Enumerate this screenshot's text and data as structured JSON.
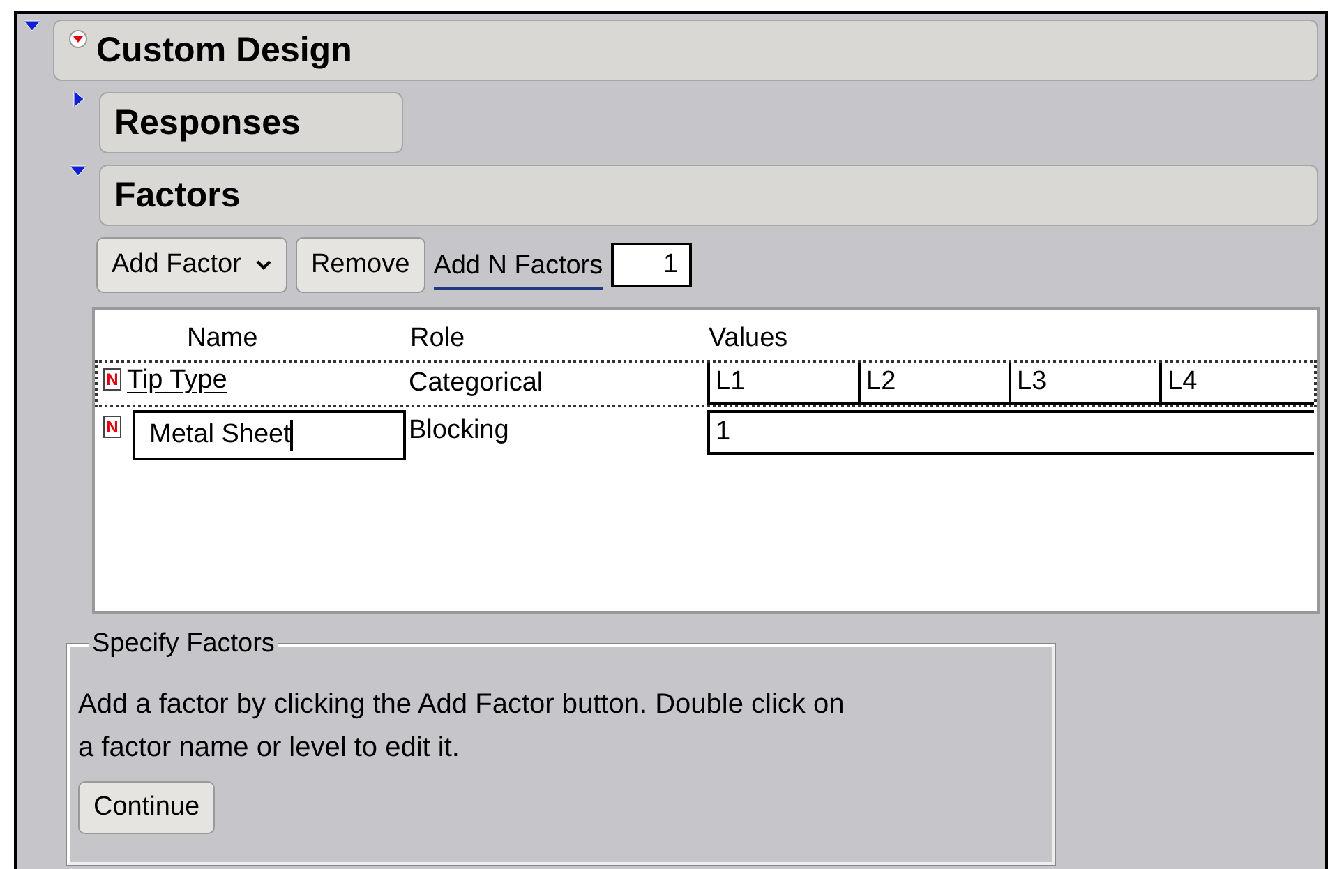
{
  "outline": {
    "title": "Custom Design",
    "expanded": true,
    "menu_open": false,
    "sections": [
      {
        "title": "Responses",
        "expanded": false
      },
      {
        "title": "Factors",
        "expanded": true
      }
    ]
  },
  "toolbar": {
    "add_factor": "Add Factor",
    "remove": "Remove",
    "add_n_label": "Add N Factors",
    "add_n_value": "1"
  },
  "table": {
    "columns": [
      "Name",
      "Role",
      "Values"
    ],
    "rows": [
      {
        "type_icon": "N",
        "name": "Tip Type",
        "role": "Categorical",
        "values": [
          "L1",
          "L2",
          "L3",
          "L4"
        ],
        "selected": true,
        "editing": false
      },
      {
        "type_icon": "N",
        "name": "Metal Sheet",
        "role": "Blocking",
        "values": [
          "1"
        ],
        "selected": false,
        "editing": true
      }
    ]
  },
  "specify": {
    "title": "Specify Factors",
    "text": "Add a factor by clicking the Add Factor button. Double click on a factor name or level to edit it.",
    "button": "Continue"
  }
}
